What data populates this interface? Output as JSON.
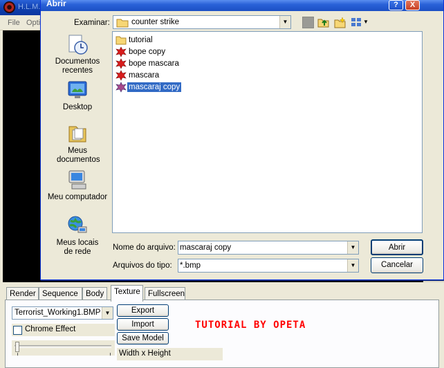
{
  "background_app": {
    "title": "H.L.M.",
    "menu": [
      "File",
      "Opti"
    ]
  },
  "dialog": {
    "title": "Abrir",
    "look_in_label": "Examinar:",
    "look_in_value": "counter strike",
    "places": [
      {
        "label": "Documentos recentes",
        "icon": "recent-documents-icon"
      },
      {
        "label": "Desktop",
        "icon": "desktop-icon"
      },
      {
        "label": "Meus documentos",
        "icon": "my-documents-icon"
      },
      {
        "label": "Meu computador",
        "icon": "my-computer-icon"
      },
      {
        "label": "Meus locais de rede",
        "icon": "network-places-icon"
      }
    ],
    "files": [
      {
        "name": "tutorial",
        "type": "folder"
      },
      {
        "name": "bope copy",
        "type": "bmp"
      },
      {
        "name": "bope mascara",
        "type": "bmp"
      },
      {
        "name": "mascara",
        "type": "bmp"
      },
      {
        "name": "mascaraj copy",
        "type": "bmp",
        "selected": true
      }
    ],
    "file_name_label": "Nome do arquivo:",
    "file_name_value": "mascaraj copy",
    "file_type_label": "Arquivos do tipo:",
    "file_type_value": "*.bmp",
    "open_label": "Abrir",
    "cancel_label": "Cancelar",
    "help_label": "?",
    "close_label": "X"
  },
  "panel": {
    "tabs": [
      "Render",
      "Sequence",
      "Body",
      "Texture",
      "Fullscreen"
    ],
    "active_tab": "Texture",
    "texture_select": "Terrorist_Working1.BMP",
    "chrome_effect_label": "Chrome Effect",
    "chrome_effect_checked": false,
    "export_label": "Export",
    "import_label": "Import",
    "save_model_label": "Save Model",
    "dimensions_label": "Width x Height",
    "overlay_text": "TUTORIAL BY OPETA",
    "slider_value": 0
  },
  "colors": {
    "titlebar_blue": "#0a36a0",
    "selection_blue": "#316ac5",
    "overlay_red": "#ff0000"
  }
}
